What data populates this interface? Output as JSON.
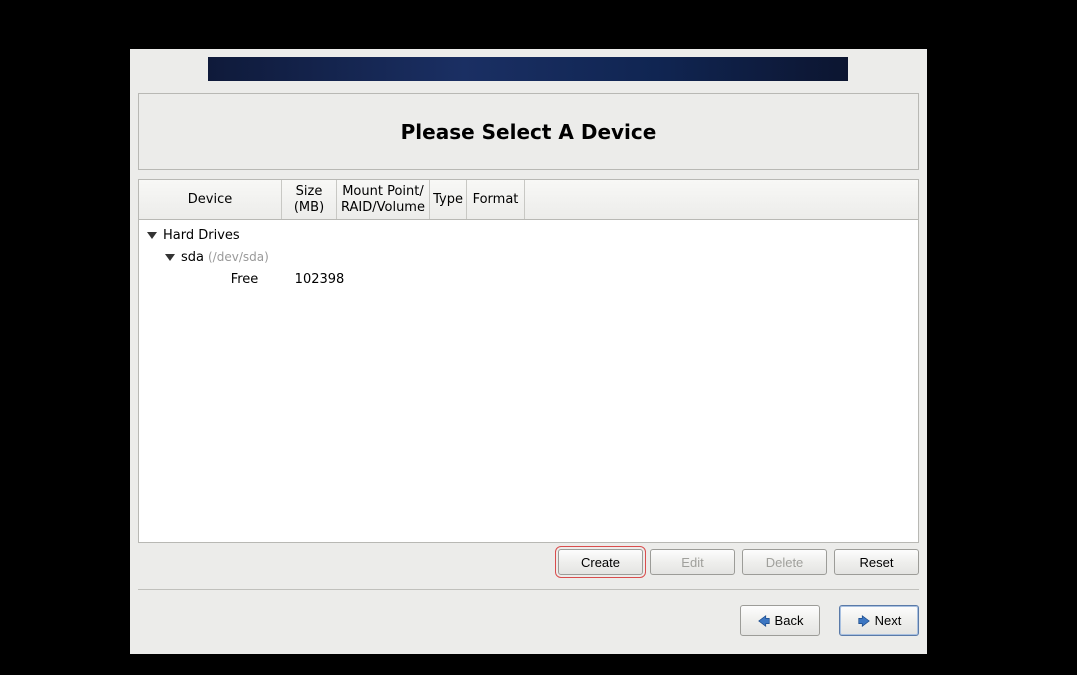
{
  "title": "Please Select A Device",
  "columns": {
    "device": "Device",
    "size_line1": "Size",
    "size_line2": "(MB)",
    "mount_line1": "Mount Point/",
    "mount_line2": "RAID/Volume",
    "type": "Type",
    "format": "Format"
  },
  "tree": {
    "root_label": "Hard Drives",
    "disk_label": "sda",
    "disk_path": "(/dev/sda)",
    "free_label": "Free",
    "free_size": "102398"
  },
  "buttons": {
    "create": "Create",
    "edit": "Edit",
    "delete": "Delete",
    "reset": "Reset",
    "back": "Back",
    "next": "Next"
  }
}
